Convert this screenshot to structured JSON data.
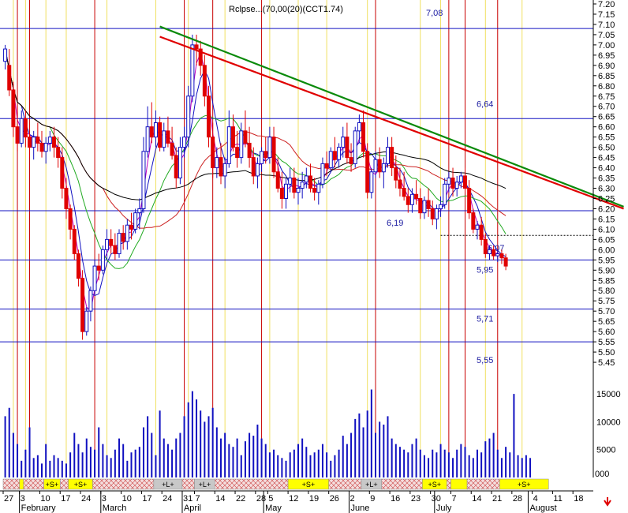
{
  "chart_data": {
    "type": "candlestick",
    "title": "",
    "title_overlay": "Rclpse...(70,00(20)(CCT1.74)",
    "price_axis": {
      "min": 5.35,
      "max": 7.2,
      "ticks": [
        "7.20",
        "7.15",
        "7.10",
        "7.05",
        "7.00",
        "6.95",
        "6.90",
        "6.85",
        "6.80",
        "6.75",
        "6.70",
        "6.65",
        "6.60",
        "6.55",
        "6.50",
        "6.45",
        "6.40",
        "6.35",
        "6.30",
        "6.25",
        "6.20",
        "6.15",
        "6.10",
        "6.05",
        "6.00",
        "5.95",
        "5.90",
        "5.85",
        "5.80",
        "5.75",
        "5.70",
        "5.65",
        "5.60",
        "5.55",
        "5.50",
        "5.45"
      ]
    },
    "volume_axis": {
      "max": 17000,
      "ticks": [
        "15000",
        "10000",
        "5000"
      ],
      "extra_label": "000"
    },
    "horizontal_levels": [
      {
        "value": 7.08,
        "label": "7,08"
      },
      {
        "value": 6.64,
        "label": "6,64"
      },
      {
        "value": 6.19,
        "label": "6,19"
      },
      {
        "value": 6.07,
        "label": "6,07",
        "style": "dotted"
      },
      {
        "value": 5.95,
        "label": "5,95"
      },
      {
        "value": 5.71,
        "label": "5,71"
      },
      {
        "value": 5.55,
        "label": "5,55"
      }
    ],
    "trendlines": [
      {
        "name": "green",
        "color": "#0a8a0a",
        "from": [
          38,
          7.09
        ],
        "to": [
          151,
          6.21
        ]
      },
      {
        "name": "red",
        "color": "#e00000",
        "from": [
          38,
          7.04
        ],
        "to": [
          151,
          6.2
        ]
      }
    ],
    "x_ticks": [
      {
        "i": 0,
        "label": "27"
      },
      {
        "i": 4,
        "label": "3"
      },
      {
        "i": 9,
        "label": "10"
      },
      {
        "i": 14,
        "label": "17"
      },
      {
        "i": 19,
        "label": "24"
      },
      {
        "i": 24,
        "label": "3"
      },
      {
        "i": 29,
        "label": "10"
      },
      {
        "i": 34,
        "label": "17"
      },
      {
        "i": 39,
        "label": "24"
      },
      {
        "i": 44,
        "label": "31"
      },
      {
        "i": 47,
        "label": "7"
      },
      {
        "i": 52,
        "label": "14"
      },
      {
        "i": 57,
        "label": "22"
      },
      {
        "i": 62,
        "label": "28"
      },
      {
        "i": 65,
        "label": "5"
      },
      {
        "i": 70,
        "label": "12"
      },
      {
        "i": 75,
        "label": "19"
      },
      {
        "i": 80,
        "label": "26"
      },
      {
        "i": 85,
        "label": "2"
      },
      {
        "i": 90,
        "label": "9"
      },
      {
        "i": 95,
        "label": "16"
      },
      {
        "i": 100,
        "label": "23"
      },
      {
        "i": 105,
        "label": "30"
      },
      {
        "i": 110,
        "label": "7"
      },
      {
        "i": 115,
        "label": "14"
      },
      {
        "i": 120,
        "label": "21"
      },
      {
        "i": 125,
        "label": "28"
      },
      {
        "i": 130,
        "label": "4"
      },
      {
        "i": 135,
        "label": "11"
      },
      {
        "i": 140,
        "label": "18"
      }
    ],
    "month_labels": [
      {
        "i": 4,
        "label": "February"
      },
      {
        "i": 24,
        "label": "March"
      },
      {
        "i": 44,
        "label": "April"
      },
      {
        "i": 64,
        "label": "May"
      },
      {
        "i": 85,
        "label": "June"
      },
      {
        "i": 106,
        "label": "July"
      },
      {
        "i": 129,
        "label": "August"
      }
    ],
    "red_vertical_lines": [
      3,
      6,
      22,
      44,
      51,
      63,
      91,
      109,
      113,
      121
    ],
    "yellow_vertical_lines": [
      2,
      5,
      10,
      15,
      25,
      37,
      45,
      54,
      65,
      72,
      79,
      89,
      102,
      107,
      118,
      127
    ],
    "signal_bar": [
      {
        "from": 0,
        "to": 4,
        "label": "",
        "fill": "hatch"
      },
      {
        "from": 4,
        "to": 5,
        "label": "",
        "fill": "yellow"
      },
      {
        "from": 5,
        "to": 10,
        "label": "",
        "fill": "hatch"
      },
      {
        "from": 10,
        "to": 14,
        "label": "+S+",
        "fill": "yellow"
      },
      {
        "from": 14,
        "to": 16,
        "label": "",
        "fill": "hatch"
      },
      {
        "from": 16,
        "to": 22,
        "label": "+S+",
        "fill": "yellow"
      },
      {
        "from": 22,
        "to": 37,
        "label": "",
        "fill": "hatch"
      },
      {
        "from": 37,
        "to": 44,
        "label": "+L+",
        "fill": "gray"
      },
      {
        "from": 44,
        "to": 47,
        "label": "",
        "fill": "hatch"
      },
      {
        "from": 47,
        "to": 52,
        "label": "+L+",
        "fill": "gray"
      },
      {
        "from": 52,
        "to": 70,
        "label": "",
        "fill": "hatch"
      },
      {
        "from": 70,
        "to": 80,
        "label": "+S+",
        "fill": "yellow"
      },
      {
        "from": 80,
        "to": 88,
        "label": "",
        "fill": "hatch"
      },
      {
        "from": 88,
        "to": 93,
        "label": "+L+",
        "fill": "gray"
      },
      {
        "from": 93,
        "to": 103,
        "label": "",
        "fill": "hatch"
      },
      {
        "from": 103,
        "to": 109,
        "label": "+S+",
        "fill": "yellow"
      },
      {
        "from": 109,
        "to": 110,
        "label": "",
        "fill": "hatch"
      },
      {
        "from": 110,
        "to": 114,
        "label": "",
        "fill": "yellow"
      },
      {
        "from": 114,
        "to": 122,
        "label": "",
        "fill": "hatch"
      },
      {
        "from": 122,
        "to": 134,
        "label": "+S+",
        "fill": "yellow"
      }
    ],
    "price_series": [
      [
        6.92,
        7.0,
        6.88,
        6.98
      ],
      [
        6.9,
        6.98,
        6.75,
        6.78
      ],
      [
        6.78,
        6.82,
        6.55,
        6.6
      ],
      [
        6.6,
        6.7,
        6.48,
        6.52
      ],
      [
        6.52,
        6.68,
        6.5,
        6.64
      ],
      [
        6.64,
        6.68,
        6.5,
        6.55
      ],
      [
        6.55,
        6.6,
        6.45,
        6.5
      ],
      [
        6.5,
        6.58,
        6.44,
        6.55
      ],
      [
        6.55,
        6.62,
        6.48,
        6.52
      ],
      [
        6.52,
        6.58,
        6.45,
        6.48
      ],
      [
        6.48,
        6.55,
        6.42,
        6.52
      ],
      [
        6.52,
        6.58,
        6.48,
        6.55
      ],
      [
        6.55,
        6.6,
        6.45,
        6.5
      ],
      [
        6.5,
        6.55,
        6.4,
        6.45
      ],
      [
        6.45,
        6.5,
        6.25,
        6.3
      ],
      [
        6.3,
        6.35,
        6.15,
        6.2
      ],
      [
        6.2,
        6.22,
        6.05,
        6.1
      ],
      [
        6.1,
        6.12,
        5.95,
        5.98
      ],
      [
        5.98,
        6.0,
        5.82,
        5.86
      ],
      [
        5.86,
        5.9,
        5.56,
        5.6
      ],
      [
        5.6,
        5.72,
        5.58,
        5.7
      ],
      [
        5.7,
        5.82,
        5.65,
        5.8
      ],
      [
        5.8,
        5.95,
        5.78,
        5.92
      ],
      [
        5.92,
        5.98,
        5.85,
        5.9
      ],
      [
        5.9,
        6.02,
        5.88,
        6.0
      ],
      [
        6.0,
        6.1,
        5.95,
        6.05
      ],
      [
        6.05,
        6.1,
        5.98,
        6.02
      ],
      [
        6.02,
        6.08,
        5.95,
        5.98
      ],
      [
        5.98,
        6.1,
        5.96,
        6.08
      ],
      [
        6.08,
        6.12,
        6.0,
        6.04
      ],
      [
        6.04,
        6.15,
        6.0,
        6.12
      ],
      [
        6.12,
        6.18,
        6.05,
        6.1
      ],
      [
        6.1,
        6.2,
        6.08,
        6.18
      ],
      [
        6.18,
        6.25,
        6.1,
        6.2
      ],
      [
        6.2,
        6.55,
        6.18,
        6.48
      ],
      [
        6.48,
        6.7,
        6.45,
        6.6
      ],
      [
        6.6,
        6.72,
        6.52,
        6.55
      ],
      [
        6.55,
        6.68,
        6.5,
        6.62
      ],
      [
        6.62,
        6.65,
        6.48,
        6.5
      ],
      [
        6.5,
        6.62,
        6.48,
        6.58
      ],
      [
        6.58,
        6.65,
        6.5,
        6.52
      ],
      [
        6.52,
        6.6,
        6.44,
        6.46
      ],
      [
        6.46,
        6.5,
        6.3,
        6.35
      ],
      [
        6.35,
        6.55,
        6.32,
        6.5
      ],
      [
        6.5,
        6.6,
        6.45,
        6.55
      ],
      [
        6.55,
        6.8,
        6.5,
        6.75
      ],
      [
        6.75,
        7.05,
        6.72,
        7.0
      ],
      [
        7.0,
        7.05,
        6.9,
        6.98
      ],
      [
        6.98,
        7.02,
        6.85,
        6.9
      ],
      [
        6.9,
        6.95,
        6.7,
        6.75
      ],
      [
        6.75,
        6.8,
        6.5,
        6.55
      ],
      [
        6.55,
        6.62,
        6.35,
        6.4
      ],
      [
        6.4,
        6.5,
        6.35,
        6.45
      ],
      [
        6.45,
        6.52,
        6.32,
        6.36
      ],
      [
        6.36,
        6.45,
        6.3,
        6.42
      ],
      [
        6.42,
        6.68,
        6.4,
        6.6
      ],
      [
        6.6,
        6.66,
        6.48,
        6.5
      ],
      [
        6.5,
        6.58,
        6.4,
        6.45
      ],
      [
        6.45,
        6.62,
        6.42,
        6.58
      ],
      [
        6.58,
        6.68,
        6.5,
        6.52
      ],
      [
        6.52,
        6.6,
        6.4,
        6.45
      ],
      [
        6.45,
        6.5,
        6.32,
        6.36
      ],
      [
        6.36,
        6.45,
        6.3,
        6.42
      ],
      [
        6.42,
        6.5,
        6.38,
        6.48
      ],
      [
        6.48,
        6.55,
        6.42,
        6.45
      ],
      [
        6.45,
        6.6,
        6.42,
        6.55
      ],
      [
        6.55,
        6.6,
        6.35,
        6.38
      ],
      [
        6.38,
        6.45,
        6.28,
        6.3
      ],
      [
        6.3,
        6.38,
        6.2,
        6.25
      ],
      [
        6.25,
        6.35,
        6.2,
        6.32
      ],
      [
        6.32,
        6.4,
        6.28,
        6.35
      ],
      [
        6.35,
        6.4,
        6.25,
        6.28
      ],
      [
        6.28,
        6.35,
        6.22,
        6.3
      ],
      [
        6.3,
        6.38,
        6.25,
        6.33
      ],
      [
        6.33,
        6.4,
        6.3,
        6.36
      ],
      [
        6.36,
        6.42,
        6.28,
        6.3
      ],
      [
        6.3,
        6.35,
        6.24,
        6.28
      ],
      [
        6.28,
        6.34,
        6.22,
        6.32
      ],
      [
        6.32,
        6.45,
        6.3,
        6.42
      ],
      [
        6.42,
        6.48,
        6.36,
        6.4
      ],
      [
        6.4,
        6.5,
        6.38,
        6.48
      ],
      [
        6.48,
        6.55,
        6.4,
        6.44
      ],
      [
        6.44,
        6.52,
        6.4,
        6.5
      ],
      [
        6.5,
        6.6,
        6.45,
        6.55
      ],
      [
        6.55,
        6.62,
        6.42,
        6.45
      ],
      [
        6.45,
        6.52,
        6.38,
        6.42
      ],
      [
        6.42,
        6.6,
        6.4,
        6.58
      ],
      [
        6.58,
        6.66,
        6.52,
        6.62
      ],
      [
        6.62,
        6.68,
        6.45,
        6.48
      ],
      [
        6.48,
        6.52,
        6.25,
        6.28
      ],
      [
        6.28,
        6.4,
        6.25,
        6.38
      ],
      [
        6.38,
        6.48,
        6.35,
        6.44
      ],
      [
        6.44,
        6.5,
        6.35,
        6.38
      ],
      [
        6.38,
        6.45,
        6.3,
        6.42
      ],
      [
        6.42,
        6.55,
        6.4,
        6.5
      ],
      [
        6.5,
        6.55,
        6.36,
        6.4
      ],
      [
        6.4,
        6.46,
        6.3,
        6.34
      ],
      [
        6.34,
        6.4,
        6.26,
        6.3
      ],
      [
        6.3,
        6.38,
        6.24,
        6.26
      ],
      [
        6.26,
        6.3,
        6.18,
        6.22
      ],
      [
        6.22,
        6.3,
        6.18,
        6.27
      ],
      [
        6.27,
        6.34,
        6.22,
        6.25
      ],
      [
        6.25,
        6.3,
        6.15,
        6.18
      ],
      [
        6.18,
        6.26,
        6.15,
        6.24
      ],
      [
        6.24,
        6.3,
        6.16,
        6.2
      ],
      [
        6.2,
        6.24,
        6.12,
        6.15
      ],
      [
        6.15,
        6.22,
        6.1,
        6.2
      ],
      [
        6.2,
        6.26,
        6.16,
        6.22
      ],
      [
        6.22,
        6.35,
        6.2,
        6.32
      ],
      [
        6.32,
        6.38,
        6.28,
        6.35
      ],
      [
        6.35,
        6.4,
        6.26,
        6.3
      ],
      [
        6.3,
        6.36,
        6.26,
        6.33
      ],
      [
        6.33,
        6.38,
        6.3,
        6.36
      ],
      [
        6.36,
        6.4,
        6.28,
        6.3
      ],
      [
        6.3,
        6.34,
        6.15,
        6.18
      ],
      [
        6.18,
        6.2,
        6.08,
        6.1
      ],
      [
        6.1,
        6.14,
        6.05,
        6.12
      ],
      [
        6.12,
        6.16,
        6.02,
        6.05
      ],
      [
        6.05,
        6.08,
        5.96,
        5.98
      ],
      [
        5.98,
        6.02,
        5.95,
        6.0
      ],
      [
        6.0,
        6.02,
        5.95,
        5.97
      ],
      [
        5.97,
        6.0,
        5.94,
        5.98
      ],
      [
        5.98,
        6.0,
        5.93,
        5.96
      ],
      [
        5.96,
        5.98,
        5.9,
        5.92
      ]
    ],
    "volume_series": [
      11000,
      12500,
      8000,
      6000,
      3000,
      5000,
      9000,
      3500,
      4000,
      2500,
      6000,
      3000,
      4000,
      3500,
      3000,
      2500,
      4500,
      8000,
      6000,
      4500,
      7000,
      5500,
      5000,
      9000,
      6000,
      4000,
      3500,
      5000,
      7000,
      6000,
      3000,
      4500,
      5000,
      5500,
      9000,
      11000,
      8000,
      4000,
      12000,
      7000,
      6000,
      5000,
      7000,
      8000,
      11000,
      13500,
      15500,
      14000,
      12000,
      10000,
      11000,
      12500,
      9000,
      7000,
      8000,
      6000,
      5500,
      7000,
      4000,
      6500,
      8000,
      7500,
      9500,
      7000,
      6000,
      4500,
      5000,
      4000,
      3500,
      3000,
      4500,
      5000,
      6000,
      7000,
      5500,
      4000,
      4500,
      5000,
      6000,
      4500,
      3000,
      4000,
      5000,
      7500,
      6000,
      8000,
      10500,
      11500,
      9000,
      12000,
      15800,
      8000,
      10000,
      9500,
      11000,
      7000,
      6000,
      5500,
      5000,
      4500,
      6000,
      7000,
      5000,
      4000,
      3500,
      5000,
      4500,
      6000,
      5000,
      4500,
      3500,
      5000,
      6000,
      5500,
      4000,
      3500,
      5000,
      4500,
      6500,
      7000,
      8000,
      5000,
      3500,
      5500,
      4500,
      15000,
      4000,
      3500,
      4000,
      3500
    ]
  }
}
